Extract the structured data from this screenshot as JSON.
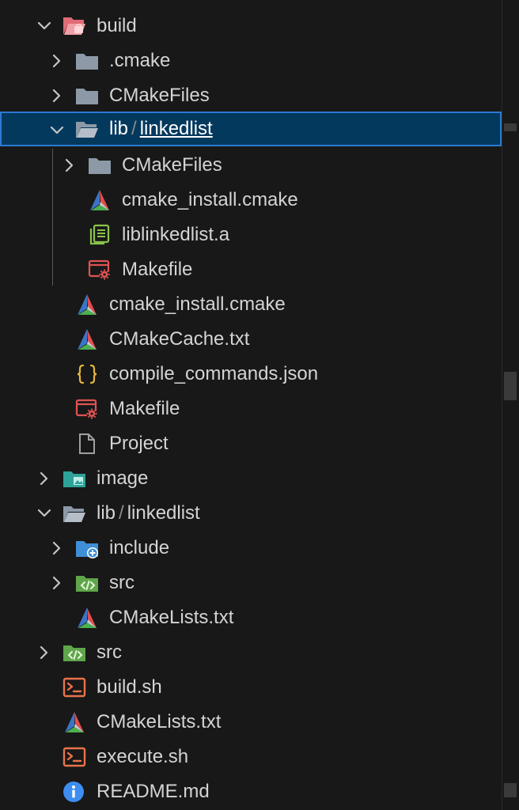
{
  "tree": [
    {
      "name": "build-folder",
      "label": "build",
      "indent": 0,
      "chevron": "down",
      "icon": "folder-build-open-icon"
    },
    {
      "name": "cmake-folder",
      "label": ".cmake",
      "indent": 1,
      "chevron": "right",
      "icon": "folder-icon"
    },
    {
      "name": "cmakefiles-folder",
      "label": "CMakeFiles",
      "indent": 1,
      "chevron": "right",
      "icon": "folder-icon"
    },
    {
      "name": "build-lib-linkedlist-folder",
      "label": "lib",
      "label2": "linkedlist",
      "indent": 1,
      "chevron": "down",
      "icon": "folder-open-icon",
      "selected": true
    },
    {
      "name": "lib-cmakefiles-folder",
      "label": "CMakeFiles",
      "indent": 2,
      "chevron": "right",
      "icon": "folder-icon"
    },
    {
      "name": "lib-cmake-install-file",
      "label": "cmake_install.cmake",
      "indent": 2,
      "chevron": "",
      "icon": "cmake-icon"
    },
    {
      "name": "liblinkedlist-file",
      "label": "liblinkedlist.a",
      "indent": 2,
      "chevron": "",
      "icon": "library-icon"
    },
    {
      "name": "lib-makefile-file",
      "label": "Makefile",
      "indent": 2,
      "chevron": "",
      "icon": "makefile-icon"
    },
    {
      "name": "cmake-install-file",
      "label": "cmake_install.cmake",
      "indent": 1,
      "chevron": "",
      "icon": "cmake-icon"
    },
    {
      "name": "cmakecache-file",
      "label": "CMakeCache.txt",
      "indent": 1,
      "chevron": "",
      "icon": "cmake-icon"
    },
    {
      "name": "compile-commands-file",
      "label": "compile_commands.json",
      "indent": 1,
      "chevron": "",
      "icon": "json-icon"
    },
    {
      "name": "build-makefile-file",
      "label": "Makefile",
      "indent": 1,
      "chevron": "",
      "icon": "makefile-icon"
    },
    {
      "name": "project-file",
      "label": "Project",
      "indent": 1,
      "chevron": "",
      "icon": "file-icon"
    },
    {
      "name": "image-folder",
      "label": "image",
      "indent": 0,
      "chevron": "right",
      "icon": "folder-image-icon"
    },
    {
      "name": "lib-linkedlist-folder",
      "label": "lib",
      "label2": "linkedlist",
      "indent": 0,
      "chevron": "down",
      "icon": "folder-open-icon"
    },
    {
      "name": "include-folder",
      "label": "include",
      "indent": 1,
      "chevron": "right",
      "icon": "folder-include-icon"
    },
    {
      "name": "lib-src-folder",
      "label": "src",
      "indent": 1,
      "chevron": "right",
      "icon": "folder-src-icon"
    },
    {
      "name": "lib-cmakelists-file",
      "label": "CMakeLists.txt",
      "indent": 1,
      "chevron": "",
      "icon": "cmake-icon"
    },
    {
      "name": "src-folder",
      "label": "src",
      "indent": 0,
      "chevron": "right",
      "icon": "folder-src-icon"
    },
    {
      "name": "build-sh-file",
      "label": "build.sh",
      "indent": 0,
      "chevron": "",
      "icon": "shell-icon"
    },
    {
      "name": "cmakelists-file",
      "label": "CMakeLists.txt",
      "indent": 0,
      "chevron": "",
      "icon": "cmake-icon"
    },
    {
      "name": "execute-sh-file",
      "label": "execute.sh",
      "indent": 0,
      "chevron": "",
      "icon": "shell-icon"
    },
    {
      "name": "readme-file",
      "label": "README.md",
      "indent": 0,
      "chevron": "",
      "icon": "info-icon"
    }
  ],
  "colors": {
    "background": "#181818",
    "selection": "#04395e",
    "selection_border": "#2d7ad3",
    "folder": "#8d99a6",
    "build_folder": "#e06c75",
    "cmake_red": "#e44d4d",
    "cmake_blue": "#3b74c6",
    "cmake_green": "#4caf50",
    "json": "#e5b73b",
    "library": "#8bc34a",
    "makefile": "#e05353",
    "shell": "#e8734a",
    "info": "#3d8ef0",
    "src_folder": "#5fa64a",
    "include_folder": "#3f8fd6",
    "image_folder": "#2ea39a"
  }
}
